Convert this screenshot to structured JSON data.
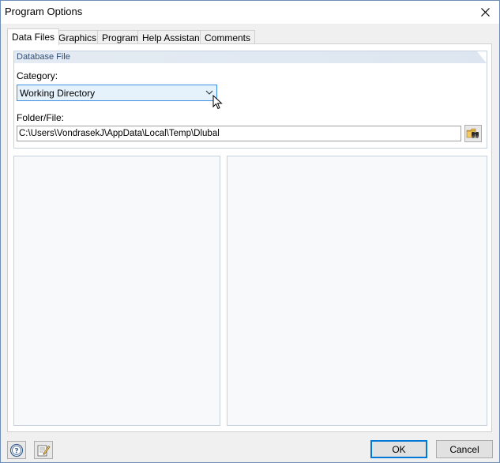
{
  "window": {
    "title": "Program Options"
  },
  "tabs": [
    {
      "label": "Data Files",
      "active": true
    },
    {
      "label": "Graphics",
      "active": false
    },
    {
      "label": "Program",
      "active": false
    },
    {
      "label": "Help Assistant",
      "active": false
    },
    {
      "label": "Comments",
      "active": false
    }
  ],
  "database_file": {
    "group_title": "Database File",
    "category_label": "Category:",
    "category_value": "Working Directory",
    "folder_label": "Folder/File:",
    "folder_value": "C:\\Users\\VondrasekJ\\AppData\\Local\\Temp\\Dlubal"
  },
  "footer": {
    "ok_label": "OK",
    "cancel_label": "Cancel"
  },
  "icons": {
    "close": "close-icon",
    "chevron": "chevron-down-icon",
    "browse": "folder-binoculars-icon",
    "help": "help-icon",
    "edit": "edit-notes-icon"
  },
  "colors": {
    "accent": "#0078d7",
    "group_border": "#c5d1de",
    "group_header_text": "#2f4f7a"
  }
}
